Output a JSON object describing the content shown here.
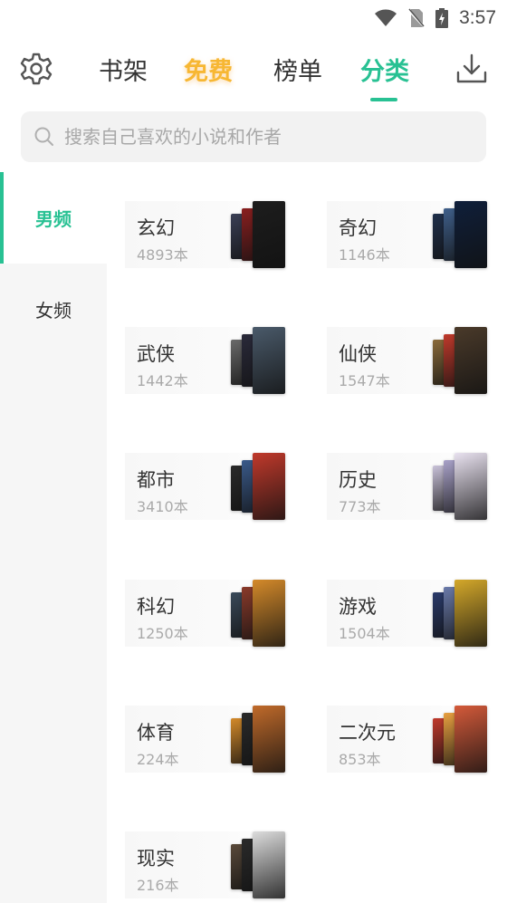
{
  "status_bar": {
    "time": "3:57"
  },
  "nav": {
    "tabs": [
      {
        "label": "书架"
      },
      {
        "label": "免费"
      },
      {
        "label": "榜单"
      },
      {
        "label": "分类"
      }
    ],
    "active_tab": "分类"
  },
  "search": {
    "placeholder": "搜索自己喜欢的小说和作者"
  },
  "sidebar": {
    "items": [
      {
        "label": "男频"
      },
      {
        "label": "女频"
      }
    ],
    "active": "男频"
  },
  "categories": [
    {
      "name": "玄幻",
      "count": "4893本",
      "covers": [
        "#3a3f55",
        "#8a1f1f",
        "#1d1d1d"
      ]
    },
    {
      "name": "奇幻",
      "count": "1146本",
      "covers": [
        "#1f2f4a",
        "#3f5f8a",
        "#0f1f3a"
      ]
    },
    {
      "name": "武侠",
      "count": "1442本",
      "covers": [
        "#6a6a6a",
        "#2a2a3a",
        "#4a5a6a"
      ]
    },
    {
      "name": "仙侠",
      "count": "1547本",
      "covers": [
        "#8a6a3a",
        "#c0392b",
        "#4a3a2a"
      ]
    },
    {
      "name": "都市",
      "count": "3410本",
      "covers": [
        "#2a2a2a",
        "#3a5a8a",
        "#c0392b"
      ]
    },
    {
      "name": "历史",
      "count": "773本",
      "covers": [
        "#c9c2d9",
        "#a9a2c9",
        "#e9e2f0"
      ]
    },
    {
      "name": "科幻",
      "count": "1250本",
      "covers": [
        "#3a4a5a",
        "#8a3a2a",
        "#d48a2a"
      ]
    },
    {
      "name": "游戏",
      "count": "1504本",
      "covers": [
        "#2a3a6a",
        "#6a7aaa",
        "#d4a82a"
      ]
    },
    {
      "name": "体育",
      "count": "224本",
      "covers": [
        "#d48a2a",
        "#2a2a2a",
        "#c06a2a"
      ]
    },
    {
      "name": "二次元",
      "count": "853本",
      "covers": [
        "#c0392b",
        "#e8a040",
        "#d45a3a"
      ]
    },
    {
      "name": "现实",
      "count": "216本",
      "covers": [
        "#5a4a3a",
        "#2a2a2a",
        "#dcdcdc"
      ]
    }
  ]
}
